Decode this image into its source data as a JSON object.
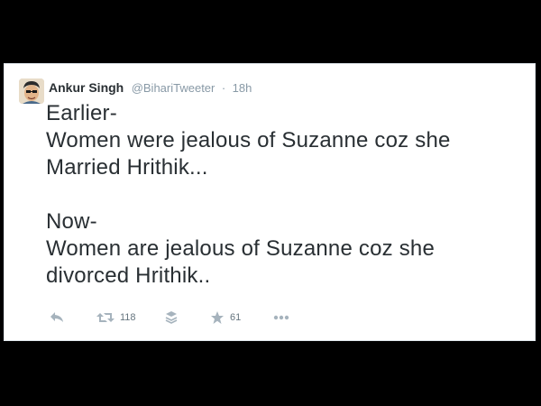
{
  "tweet": {
    "author_name": "Ankur Singh",
    "author_handle": "@BihariTweeter",
    "separator": "·",
    "time": "18h",
    "lines": [
      "Earlier-",
      "Women were jealous of Suzanne coz she",
      "Married Hrithik...",
      "",
      "Now-",
      "Women are jealous of Suzanne coz she",
      "divorced Hrithik.."
    ]
  },
  "actions": {
    "reply_icon": "reply-icon",
    "retweet_icon": "retweet-icon",
    "retweet_count": "118",
    "buffer_icon": "buffer-stack-icon",
    "favorite_icon": "star-icon",
    "favorite_count": "61",
    "more_icon": "more-dots-icon"
  },
  "colors": {
    "background": "#000000",
    "card": "#ffffff",
    "text": "#292f33",
    "muted": "#8899a6",
    "icon": "#a6b3bd"
  }
}
